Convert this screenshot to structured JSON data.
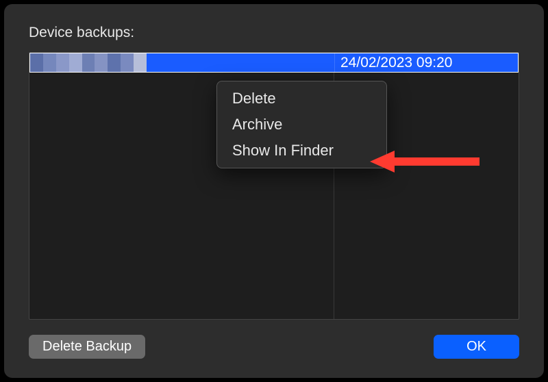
{
  "title": "Device backups:",
  "row": {
    "date": "24/02/2023 09:20"
  },
  "menu": {
    "delete": "Delete",
    "archive": "Archive",
    "show_in_finder": "Show In Finder"
  },
  "buttons": {
    "delete_backup": "Delete Backup",
    "ok": "OK"
  },
  "colors": {
    "selection": "#1a5cff",
    "primary_button": "#0a60ff",
    "arrow": "#ff3b30"
  }
}
